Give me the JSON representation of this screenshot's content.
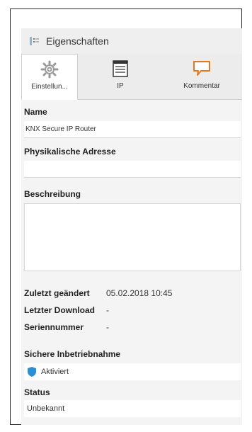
{
  "panel": {
    "title": "Eigenschaften",
    "title_icon": "properties-icon"
  },
  "tabs": [
    {
      "label": "Einstellun...",
      "icon": "gear-icon",
      "active": true
    },
    {
      "label": "IP",
      "icon": "ip-config-icon",
      "active": false
    },
    {
      "label": "Kommentar",
      "icon": "comment-icon",
      "active": false
    }
  ],
  "fields": {
    "name_label": "Name",
    "name_value": "KNX Secure IP Router",
    "address_label": "Physikalische Adresse",
    "address_value": "",
    "description_label": "Beschreibung",
    "description_value": ""
  },
  "info": {
    "last_changed_label": "Zuletzt geändert",
    "last_changed_value": "05.02.2018 10:45",
    "last_download_label": "Letzter Download",
    "last_download_value": "-",
    "serial_label": "Seriennummer",
    "serial_value": "-"
  },
  "secure": {
    "label": "Sichere Inbetriebnahme",
    "value": "Aktiviert",
    "icon": "shield-icon",
    "icon_color": "#2b8fd6"
  },
  "status": {
    "label": "Status",
    "value": "Unbekannt"
  }
}
